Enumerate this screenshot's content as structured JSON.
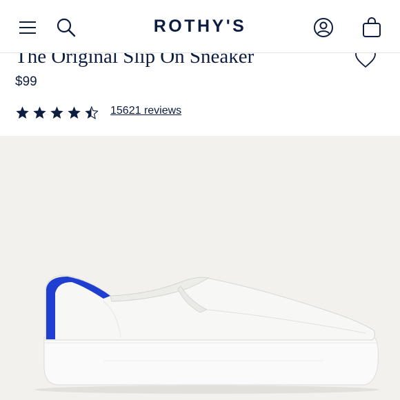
{
  "header": {
    "logo_text": "ROTHY'S",
    "icons": [
      "menu-icon",
      "search-icon",
      "account-icon",
      "bag-icon"
    ]
  },
  "product": {
    "title": "The Original Slip On Sneaker",
    "price": "$99",
    "rating": 4.5,
    "rating_max": 5,
    "reviews_label": "15621 reviews"
  },
  "colors": {
    "navy": "#0d1d3f",
    "image_background": "#f2f1ee",
    "accent_blue": "#1f3fd1"
  }
}
